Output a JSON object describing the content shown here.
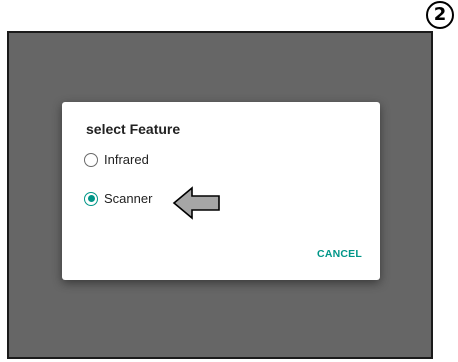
{
  "step_badge": "2",
  "dialog": {
    "title": "select Feature",
    "options": [
      {
        "label": "Infrared",
        "selected": false
      },
      {
        "label": "Scanner",
        "selected": true
      }
    ],
    "cancel_label": "CANCEL"
  },
  "colors": {
    "accent": "#009688",
    "overlay": "#666666",
    "arrow_fill": "#a6a6a6"
  },
  "icons": {
    "step": "circled-number-icon",
    "pointer": "left-arrow-icon"
  }
}
